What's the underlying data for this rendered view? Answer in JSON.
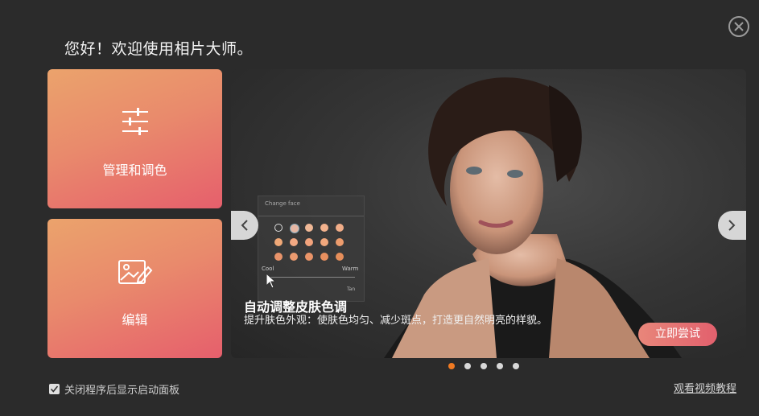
{
  "window": {
    "close_icon": "close-icon"
  },
  "header": {
    "welcome_text": "您好！欢迎使用相片大师。"
  },
  "tiles": [
    {
      "label": "管理和调色",
      "icon": "sliders-icon"
    },
    {
      "label": "编辑",
      "icon": "image-edit-icon"
    }
  ],
  "banner": {
    "title": "自动调整皮肤色调",
    "description": "提升肤色外观：使肤色均匀、减少斑点，打造更自然明亮的样貌。",
    "try_button": "立即尝试",
    "panel": {
      "title": "Change face",
      "warm_label": "Warm",
      "cool_label": "Cool",
      "tan_label": "Tan"
    },
    "prev_icon": "chevron-left-icon",
    "next_icon": "chevron-right-icon"
  },
  "carousel": {
    "page_count": 5,
    "active_index": 0,
    "active_color": "#f07a22"
  },
  "footer": {
    "show_panel_checkbox": {
      "label": "关闭程序后显示启动面板",
      "checked": true
    },
    "video_link": "观看视频教程"
  },
  "colors": {
    "background": "#2b2b2b",
    "tile_gradient_start": "#eba36c",
    "tile_gradient_end": "#e65f6c",
    "accent": "#f07a22"
  }
}
